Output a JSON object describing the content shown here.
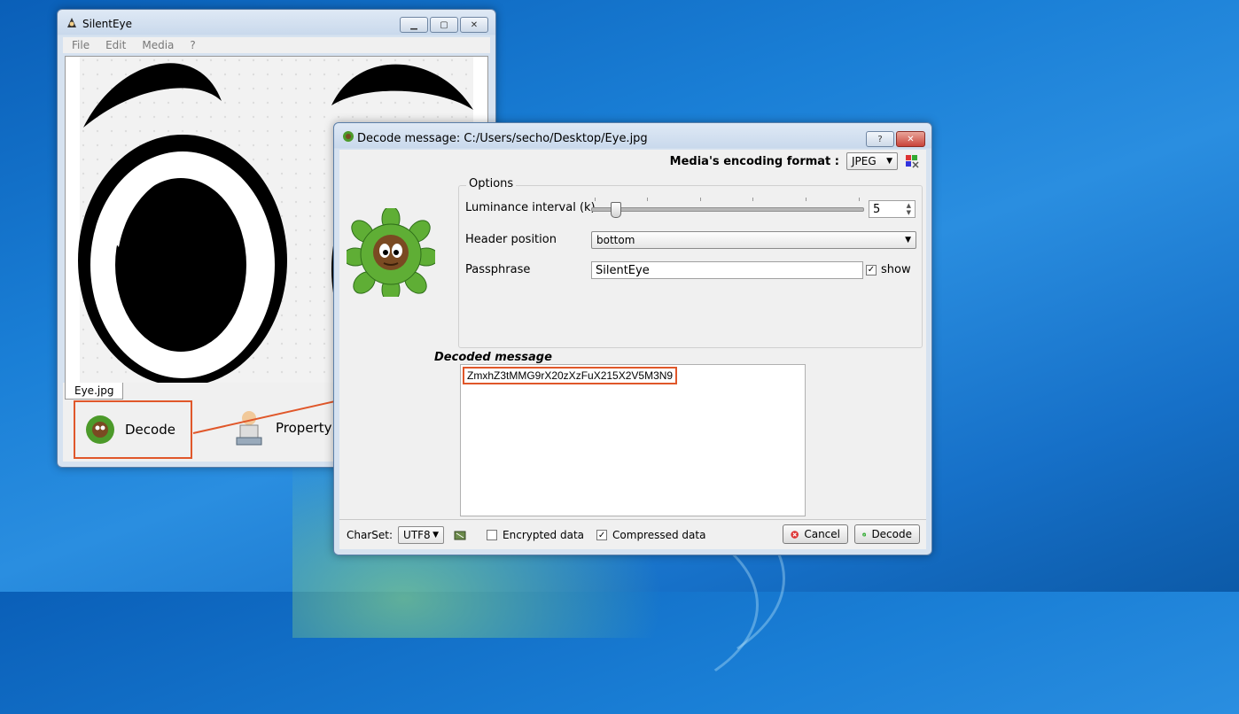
{
  "main_window": {
    "title": "SilentEye",
    "menu": [
      "File",
      "Edit",
      "Media",
      "?"
    ],
    "tab_label": "Eye.jpg",
    "decode_label": "Decode",
    "property_label": "Property"
  },
  "dialog": {
    "title": "Decode message: C:/Users/secho/Desktop/Eye.jpg",
    "help_glyph": "?",
    "close_glyph": "✕",
    "encoding_label": "Media's encoding format :",
    "encoding_value": "JPEG",
    "options_title": "Options",
    "luminance_label": "Luminance interval (k)",
    "luminance_value": "5",
    "header_position_label": "Header position",
    "header_position_value": "bottom",
    "passphrase_label": "Passphrase",
    "passphrase_value": "SilentEye",
    "show_label": "show",
    "show_checked": true,
    "decoded_title": "Decoded message",
    "decoded_message": "ZmxhZ3tMMG9rX20zXzFuX215X2V5M3N9",
    "charset_label": "CharSet:",
    "charset_value": "UTF8",
    "encrypted_label": "Encrypted data",
    "encrypted_checked": false,
    "compressed_label": "Compressed data",
    "compressed_checked": true,
    "cancel_label": "Cancel",
    "decode_label": "Decode"
  },
  "colors": {
    "highlight": "#e0572a",
    "desktop": "#1a7fd6"
  }
}
